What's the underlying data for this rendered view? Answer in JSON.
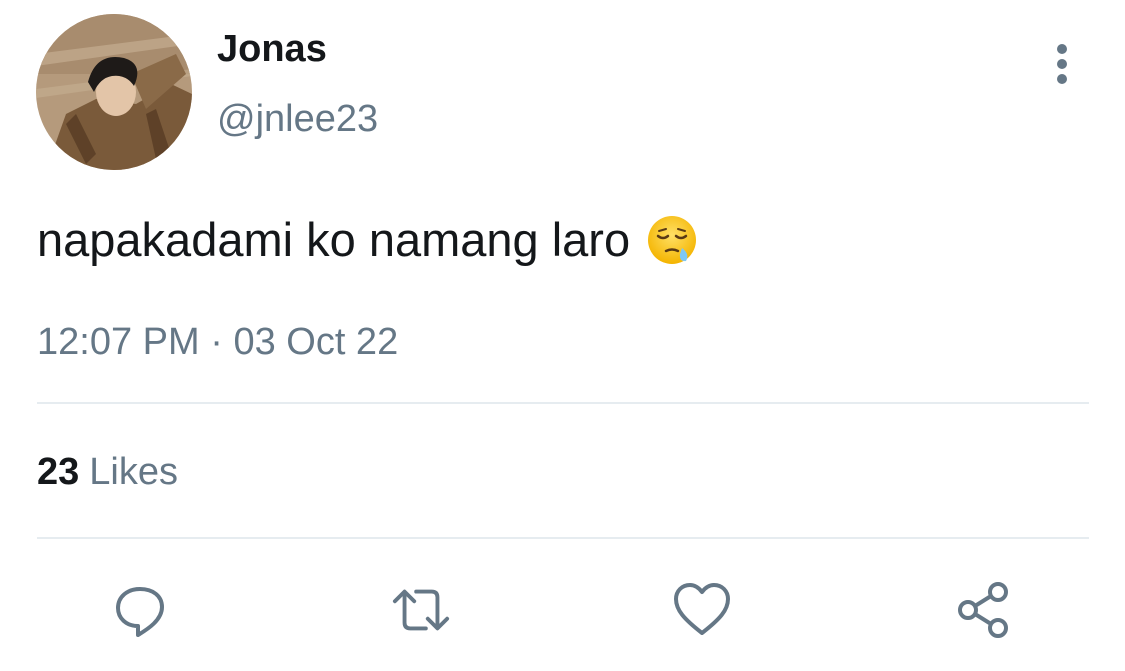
{
  "user": {
    "display_name": "Jonas",
    "handle": "@jnlee23",
    "avatar_icon": "profile-photo"
  },
  "tweet": {
    "text": "napakadami ko namang laro",
    "emoji": "sleepy-face-emoji",
    "time": "12:07 PM",
    "separator": "·",
    "date": "03 Oct 22"
  },
  "stats": {
    "likes_count": "23",
    "likes_label": "Likes"
  },
  "actions": [
    {
      "icon": "reply-icon"
    },
    {
      "icon": "retweet-icon"
    },
    {
      "icon": "like-heart-icon"
    },
    {
      "icon": "share-icon"
    }
  ],
  "colors": {
    "text_primary": "#14171a",
    "text_secondary": "#657786",
    "divider": "#e6ecf0"
  }
}
